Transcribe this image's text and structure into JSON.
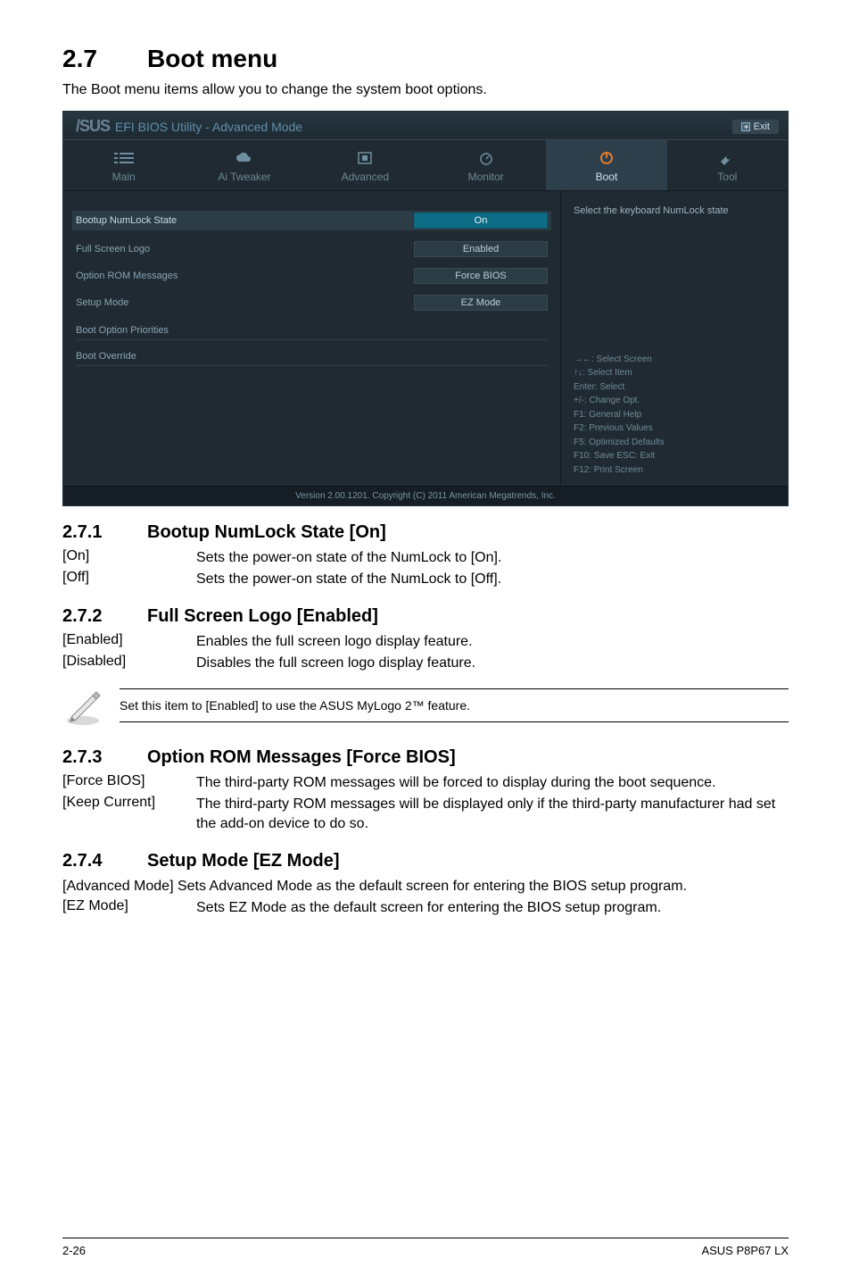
{
  "page": {
    "section_number": "2.7",
    "section_title": "Boot menu",
    "intro": "The Boot menu items allow you to change the system boot options."
  },
  "bios": {
    "header_title": "EFI BIOS Utility - Advanced Mode",
    "brand": "/SUS",
    "exit_label": "Exit",
    "tabs": {
      "main": "Main",
      "ai_tweaker": "Ai  Tweaker",
      "advanced": "Advanced",
      "monitor": "Monitor",
      "boot": "Boot",
      "tool": "Tool"
    },
    "options": {
      "numlock": {
        "label": "Bootup NumLock State",
        "value": "On"
      },
      "fullscreen": {
        "label": "Full Screen Logo",
        "value": "Enabled"
      },
      "optrom": {
        "label": "Option ROM Messages",
        "value": "Force BIOS"
      },
      "setup": {
        "label": "Setup Mode",
        "value": "EZ Mode"
      }
    },
    "section_heads": {
      "boot_priorities": "Boot Option Priorities",
      "boot_override": "Boot Override"
    },
    "help_top": "Select the keyboard NumLock state",
    "keys": {
      "l1": "→←:  Select Screen",
      "l2": "↑↓:  Select Item",
      "l3": "Enter:  Select",
      "l4": "+/-:  Change Opt.",
      "l5": "F1:  General Help",
      "l6": "F2:  Previous Values",
      "l7": "F5:  Optimized Defaults",
      "l8": "F10:  Save   ESC:  Exit",
      "l9": "F12: Print Screen"
    },
    "footer": "Version  2.00.1201.   Copyright  (C)  2011 American  Megatrends,  Inc."
  },
  "s271": {
    "num": "2.7.1",
    "title": "Bootup NumLock State [On]",
    "rows": {
      "on_k": "[On]",
      "on_v": "Sets the power-on state of the NumLock to [On].",
      "off_k": "[Off]",
      "off_v": "Sets the power-on state of the NumLock to [Off]."
    }
  },
  "s272": {
    "num": "2.7.2",
    "title": "Full Screen Logo [Enabled]",
    "rows": {
      "en_k": "[Enabled]",
      "en_v": "Enables the full screen logo display feature.",
      "dis_k": "[Disabled]",
      "dis_v": "Disables the full screen logo display feature."
    },
    "note": "Set this item to [Enabled] to use the ASUS MyLogo 2™ feature."
  },
  "s273": {
    "num": "2.7.3",
    "title": "Option ROM Messages [Force BIOS]",
    "rows": {
      "fb_k": "[Force BIOS]",
      "fb_v": "The third-party ROM messages will be forced to display during the boot sequence.",
      "kc_k": "[Keep Current]",
      "kc_v": "The third-party ROM messages will be displayed only if the third-party manufacturer had set the add-on device to do so."
    }
  },
  "s274": {
    "num": "2.7.4",
    "title": "Setup Mode [EZ Mode]",
    "adv_line": "[Advanced Mode]  Sets Advanced Mode as the default screen for entering the BIOS setup program.",
    "rows": {
      "ez_k": "[EZ Mode]",
      "ez_v": "Sets EZ Mode as the default screen for entering the BIOS setup program."
    }
  },
  "footer": {
    "left": "2-26",
    "right": "ASUS P8P67 LX"
  }
}
